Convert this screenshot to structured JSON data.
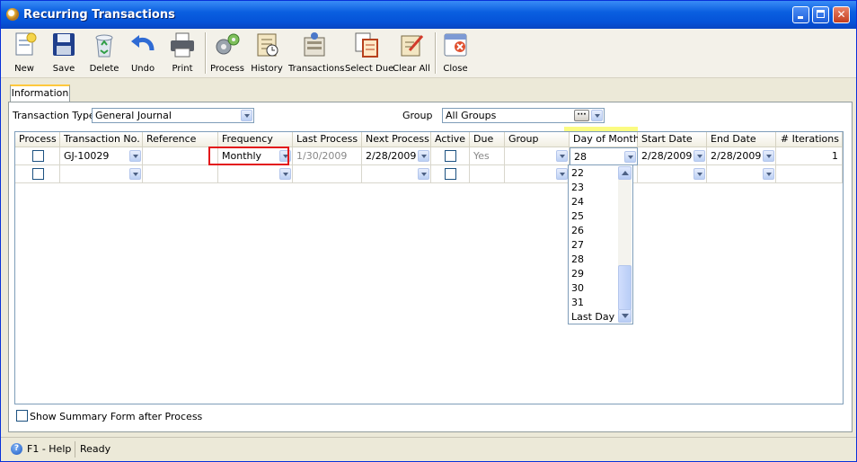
{
  "window": {
    "title": "Recurring Transactions"
  },
  "toolbar": {
    "items": [
      {
        "label": "New",
        "icon": "new-document-icon"
      },
      {
        "label": "Save",
        "icon": "floppy-disk-icon"
      },
      {
        "label": "Delete",
        "icon": "recycle-bin-icon"
      },
      {
        "label": "Undo",
        "icon": "undo-arrow-icon"
      },
      {
        "label": "Print",
        "icon": "printer-icon"
      },
      {
        "label": "Process",
        "icon": "gears-icon"
      },
      {
        "label": "History",
        "icon": "history-icon"
      },
      {
        "label": "Transactions",
        "icon": "transactions-icon"
      },
      {
        "label": "Select Due",
        "icon": "select-due-icon"
      },
      {
        "label": "Clear All",
        "icon": "clear-all-icon"
      },
      {
        "label": "Close",
        "icon": "close-window-icon"
      }
    ]
  },
  "tabs": [
    {
      "label": "Information",
      "active": true
    }
  ],
  "filters": {
    "transaction_type_label": "Transaction Type",
    "transaction_type_value": "General Journal",
    "group_label": "Group",
    "group_value": "All Groups",
    "ellipsis": "···"
  },
  "grid": {
    "columns": [
      "Process",
      "Transaction No.",
      "Reference",
      "Frequency",
      "Last Process",
      "Next Process",
      "Active",
      "Due",
      "Group",
      "Day of Month",
      "Start Date",
      "End Date",
      "# Iterations"
    ],
    "rows": [
      {
        "process": false,
        "transaction_no": "GJ-10029",
        "reference": "",
        "frequency": "Monthly",
        "last_process": "1/30/2009",
        "next_process": "2/28/2009",
        "active": false,
        "due": "Yes",
        "group": "",
        "day_of_month": "28",
        "start_date": "2/28/2009",
        "end_date": "2/28/2009",
        "iterations": "1"
      },
      {
        "process": false,
        "transaction_no": "",
        "reference": "",
        "frequency": "",
        "last_process": "",
        "next_process": "",
        "active": false,
        "due": "",
        "group": "",
        "day_of_month": "",
        "start_date": "",
        "end_date": "",
        "iterations": ""
      }
    ]
  },
  "day_dropdown": {
    "options": [
      "22",
      "23",
      "24",
      "25",
      "26",
      "27",
      "28",
      "29",
      "30",
      "31",
      "Last Day"
    ]
  },
  "footer": {
    "show_summary_label": "Show Summary Form after Process",
    "show_summary_checked": false
  },
  "status": {
    "help": "F1 - Help",
    "state": "Ready"
  },
  "colors": {
    "titlebar": "#0553d8",
    "highlight_yellow": "#fafa50",
    "frequency_outline": "#e3181b"
  }
}
